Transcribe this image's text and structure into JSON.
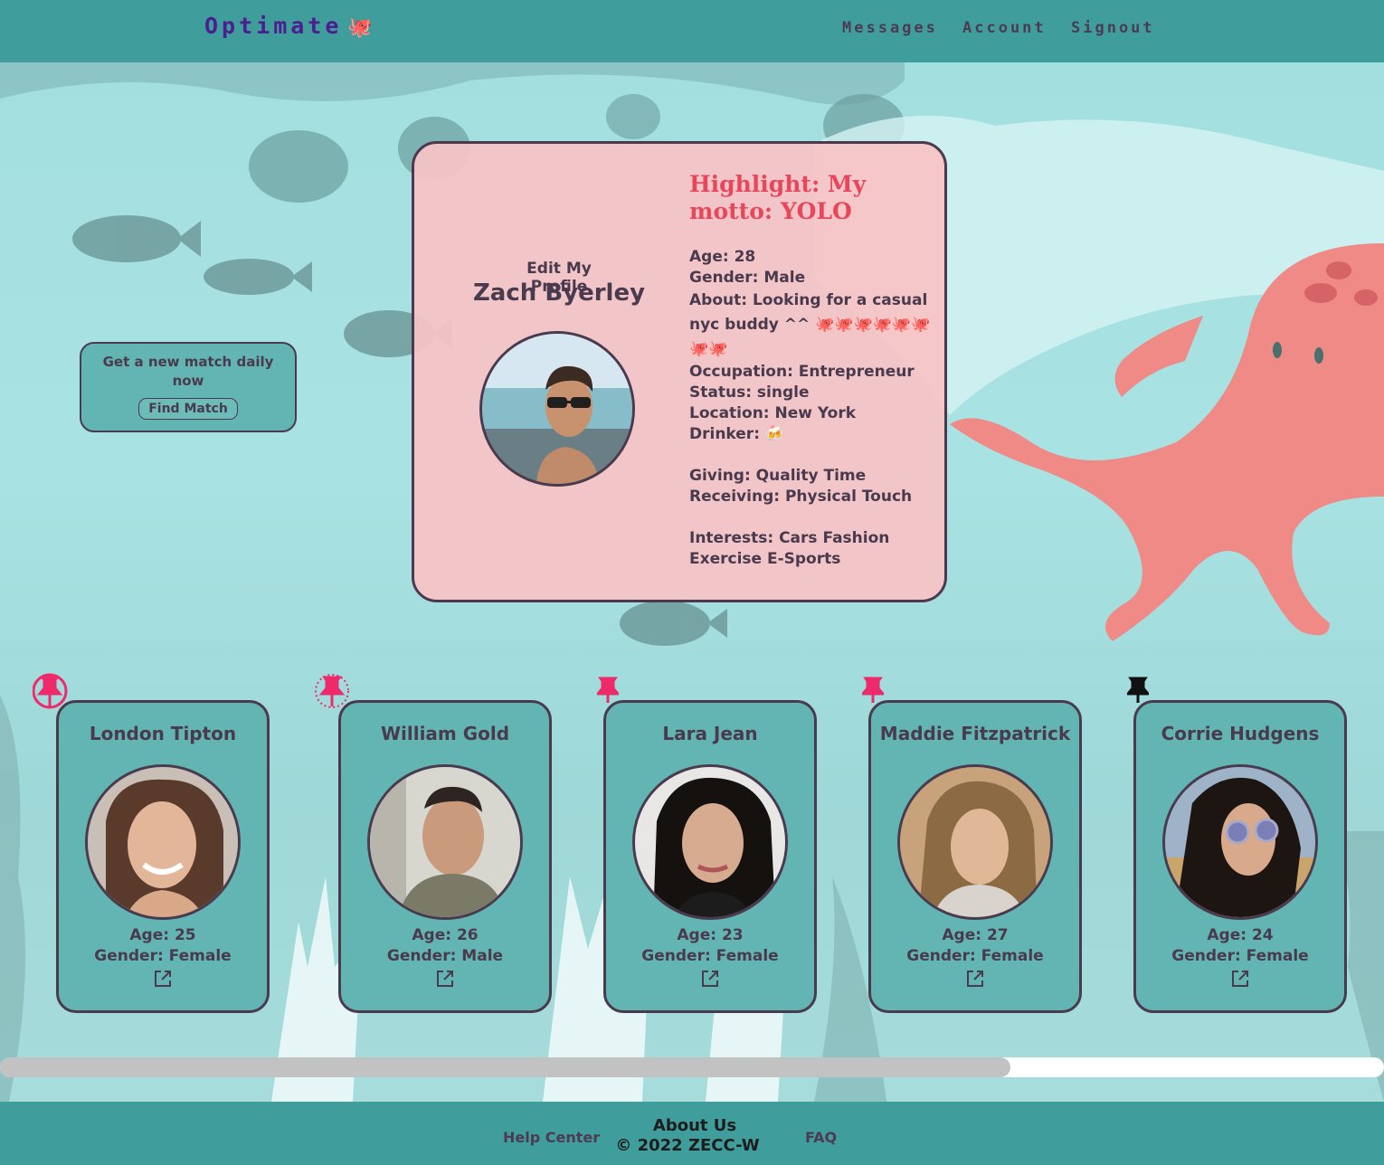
{
  "header": {
    "brand": "Optimate",
    "brand_icon": "🐙",
    "nav": {
      "messages": "Messages",
      "account": "Account",
      "signout": "Signout"
    }
  },
  "match_box": {
    "text": "Get a new match daily now",
    "button": "Find Match"
  },
  "profile": {
    "edit_label": "Edit My Profile",
    "name": "Zach Byerley",
    "highlight": "Highlight: My motto: YOLO",
    "age": "Age: 28",
    "gender": "Gender: Male",
    "about": "About: Looking for a casual nyc buddy ^^ 🐙🐙🐙🐙🐙🐙🐙🐙",
    "occupation": "Occupation: Entrepreneur",
    "status": "Status: single",
    "location": "Location: New York",
    "drinker": "Drinker: 🍻",
    "giving": "Giving: Quality Time",
    "receiving": "Receiving: Physical Touch",
    "interests": "Interests: Cars Fashion Exercise E-Sports"
  },
  "cards": [
    {
      "name": "London Tipton",
      "age": "Age: 25",
      "gender": "Gender: Female",
      "pin": "pin-circled"
    },
    {
      "name": "William Gold",
      "age": "Age: 26",
      "gender": "Gender: Male",
      "pin": "pin-dotted-circle"
    },
    {
      "name": "Lara Jean",
      "age": "Age: 23",
      "gender": "Gender: Female",
      "pin": "pin"
    },
    {
      "name": "Maddie Fitzpatrick",
      "age": "Age: 27",
      "gender": "Gender: Female",
      "pin": "pin"
    },
    {
      "name": "Corrie Hudgens",
      "age": "Age: 24",
      "gender": "Gender: Female",
      "pin": "pin-black"
    }
  ],
  "footer": {
    "help": "Help Center",
    "about": "About Us",
    "copyright": "© 2022 ZECC-W",
    "faq": "FAQ"
  },
  "colors": {
    "header_bg": "#3f9d9b",
    "brand": "#4b1f8f",
    "card_bg": "#62b5b3",
    "profile_bg": "#f8c4c6",
    "highlight": "#e8465b",
    "pin": "#ee2a6b"
  }
}
